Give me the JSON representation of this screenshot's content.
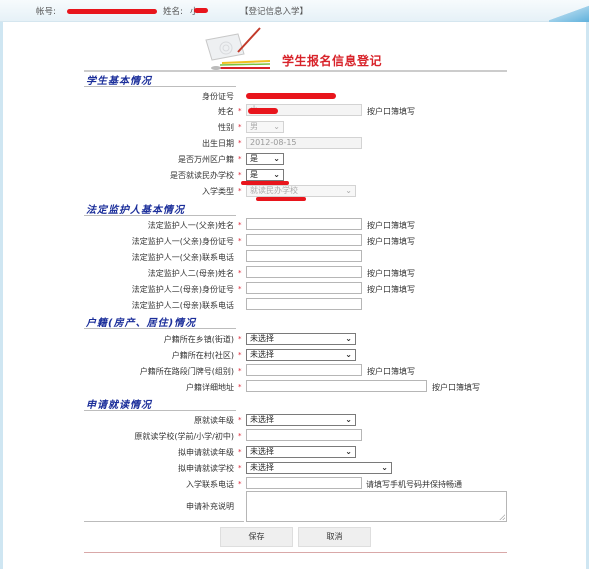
{
  "topbar": {
    "account_label": "帐号:",
    "name_label": "姓名:",
    "name_value": "小",
    "mode_label": "【登记信息入学】"
  },
  "page_title": "学生报名信息登记",
  "sections": {
    "student": {
      "title": "学生基本情况",
      "id_label": "身份证号",
      "id_value": "",
      "name_label": "姓名",
      "name_value": "小",
      "name_hint": "按户口簿填写",
      "gender_label": "性别",
      "gender_value": "男",
      "birth_label": "出生日期",
      "birth_value": "2012-08-15",
      "wanzhou_label": "是否万州区户籍",
      "wanzhou_value": "是",
      "private_label": "是否就读民办学校",
      "private_value": "是",
      "type_label": "入学类型",
      "type_value": "就读民办学校"
    },
    "guardian": {
      "title": "法定监护人基本情况",
      "rows": [
        {
          "label": "法定监护人一(父亲)姓名",
          "required": true,
          "value": "",
          "hint": "按户口簿填写"
        },
        {
          "label": "法定监护人一(父亲)身份证号",
          "required": true,
          "value": "",
          "hint": "按户口簿填写"
        },
        {
          "label": "法定监护人一(父亲)联系电话",
          "required": false,
          "value": "",
          "hint": ""
        },
        {
          "label": "法定监护人二(母亲)姓名",
          "required": true,
          "value": "",
          "hint": "按户口簿填写"
        },
        {
          "label": "法定监护人二(母亲)身份证号",
          "required": true,
          "value": "",
          "hint": "按户口簿填写"
        },
        {
          "label": "法定监护人二(母亲)联系电话",
          "required": false,
          "value": "",
          "hint": ""
        }
      ]
    },
    "household": {
      "title": "户籍(房产、居住)情况",
      "town_label": "户籍所在乡镇(街道)",
      "town_value": "未选择",
      "village_label": "户籍所在村(社区)",
      "village_value": "未选择",
      "door_label": "户籍所在路段门牌号(组别)",
      "door_value": "",
      "door_hint": "按户口簿填写",
      "address_label": "户籍详细地址",
      "address_value": "",
      "address_hint": "按户口簿填写"
    },
    "apply": {
      "title": "申请就读情况",
      "orig_grade_label": "原就读年级",
      "orig_grade_value": "未选择",
      "orig_school_label": "原就读学校(学前/小学/初中)",
      "orig_school_value": "",
      "apply_grade_label": "拟申请就读年级",
      "apply_grade_value": "未选择",
      "apply_school_label": "拟申请就读学校",
      "apply_school_value": "未选择",
      "phone_label": "入学联系电话",
      "phone_value": "",
      "phone_hint": "请填写手机号码并保持畅通",
      "note_label": "申请补充说明",
      "note_value": ""
    }
  },
  "buttons": {
    "save": "保存",
    "cancel": "取消"
  },
  "required_mark": "*",
  "colors": {
    "section_title": "#1b2e9a",
    "page_title": "#d8232a",
    "required": "#dd2233",
    "redaction": "#e8151c"
  }
}
